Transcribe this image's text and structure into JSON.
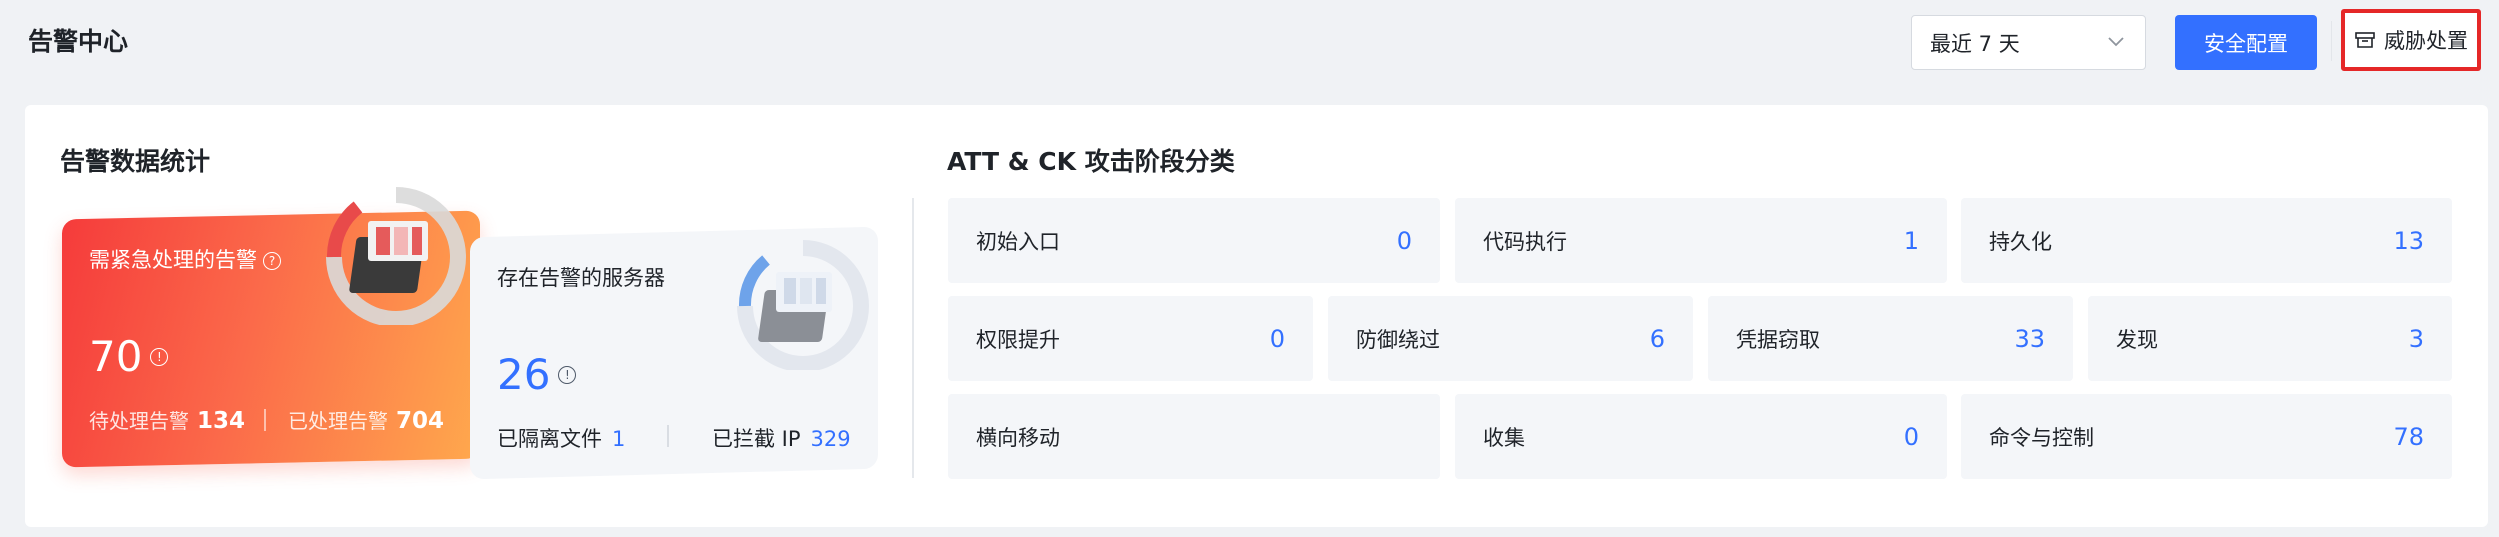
{
  "header": {
    "title": "告警中心",
    "time_range": "最近 7 天",
    "security_config_label": "安全配置",
    "threat_handling_label": "威胁处置"
  },
  "stats": {
    "title": "告警数据统计",
    "urgent": {
      "title": "需紧急处理的告警",
      "count": "70",
      "pending_label": "待处理告警",
      "pending_value": "134",
      "handled_label": "已处理告警",
      "handled_value": "704"
    },
    "servers": {
      "title": "存在告警的服务器",
      "count": "26",
      "isolated_label": "已隔离文件",
      "isolated_value": "1",
      "blocked_label": "已拦截 IP",
      "blocked_value": "329"
    }
  },
  "attck": {
    "title": "ATT & CK 攻击阶段分类",
    "row1": [
      {
        "label": "初始入口",
        "value": "0"
      },
      {
        "label": "代码执行",
        "value": "1"
      },
      {
        "label": "持久化",
        "value": "13"
      }
    ],
    "row2": [
      {
        "label": "权限提升",
        "value": "0"
      },
      {
        "label": "防御绕过",
        "value": "6"
      },
      {
        "label": "凭据窃取",
        "value": "33"
      },
      {
        "label": "发现",
        "value": "3"
      }
    ],
    "row3": [
      {
        "label": "横向移动",
        "value": ""
      },
      {
        "label": "收集",
        "value": "0"
      },
      {
        "label": "命令与控制",
        "value": "78"
      }
    ]
  },
  "colors": {
    "primary": "#3370ff",
    "urgent_gradient_start": "#f53b3b",
    "urgent_gradient_end": "#ffa94d",
    "highlight_border": "#e52828"
  },
  "icons": {
    "dropdown": "chevron-down-icon",
    "threat": "archive-box-icon",
    "help": "question-circle-icon",
    "info": "info-circle-icon"
  }
}
